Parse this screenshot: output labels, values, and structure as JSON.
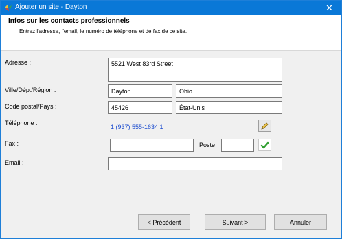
{
  "window": {
    "title": "Ajouter un site - Dayton",
    "close_glyph": "✕"
  },
  "header": {
    "title": "Infos sur les contacts professionnels",
    "subtitle": "Entrez l'adresse, l'email, le numéro de téléphone et de fax de ce site."
  },
  "form": {
    "address_label": "Adresse :",
    "address_value": "5521 West 83rd Street",
    "city_label": "Ville/Dép./Région :",
    "city_value": "Dayton",
    "region_value": "Ohio",
    "postal_label": "Code postal/Pays :",
    "postal_value": "45426",
    "country_value": "État-Unis",
    "phone_label": "Téléphone :",
    "phone_value": "1 (937) 555-1634 1",
    "fax_label": "Fax :",
    "fax_value": "",
    "extension_label": "Poste",
    "extension_value": "",
    "email_label": "Email :",
    "email_value": ""
  },
  "buttons": {
    "previous": "< Précédent",
    "next": "Suivant >",
    "cancel": "Annuler"
  },
  "icons": {
    "app": "app-logo-icon",
    "edit": "pencil-icon",
    "confirm": "checkmark-icon"
  },
  "colors": {
    "title_bar": "#0a78d7",
    "link": "#1f4fcf",
    "check": "#2e9e2e"
  }
}
